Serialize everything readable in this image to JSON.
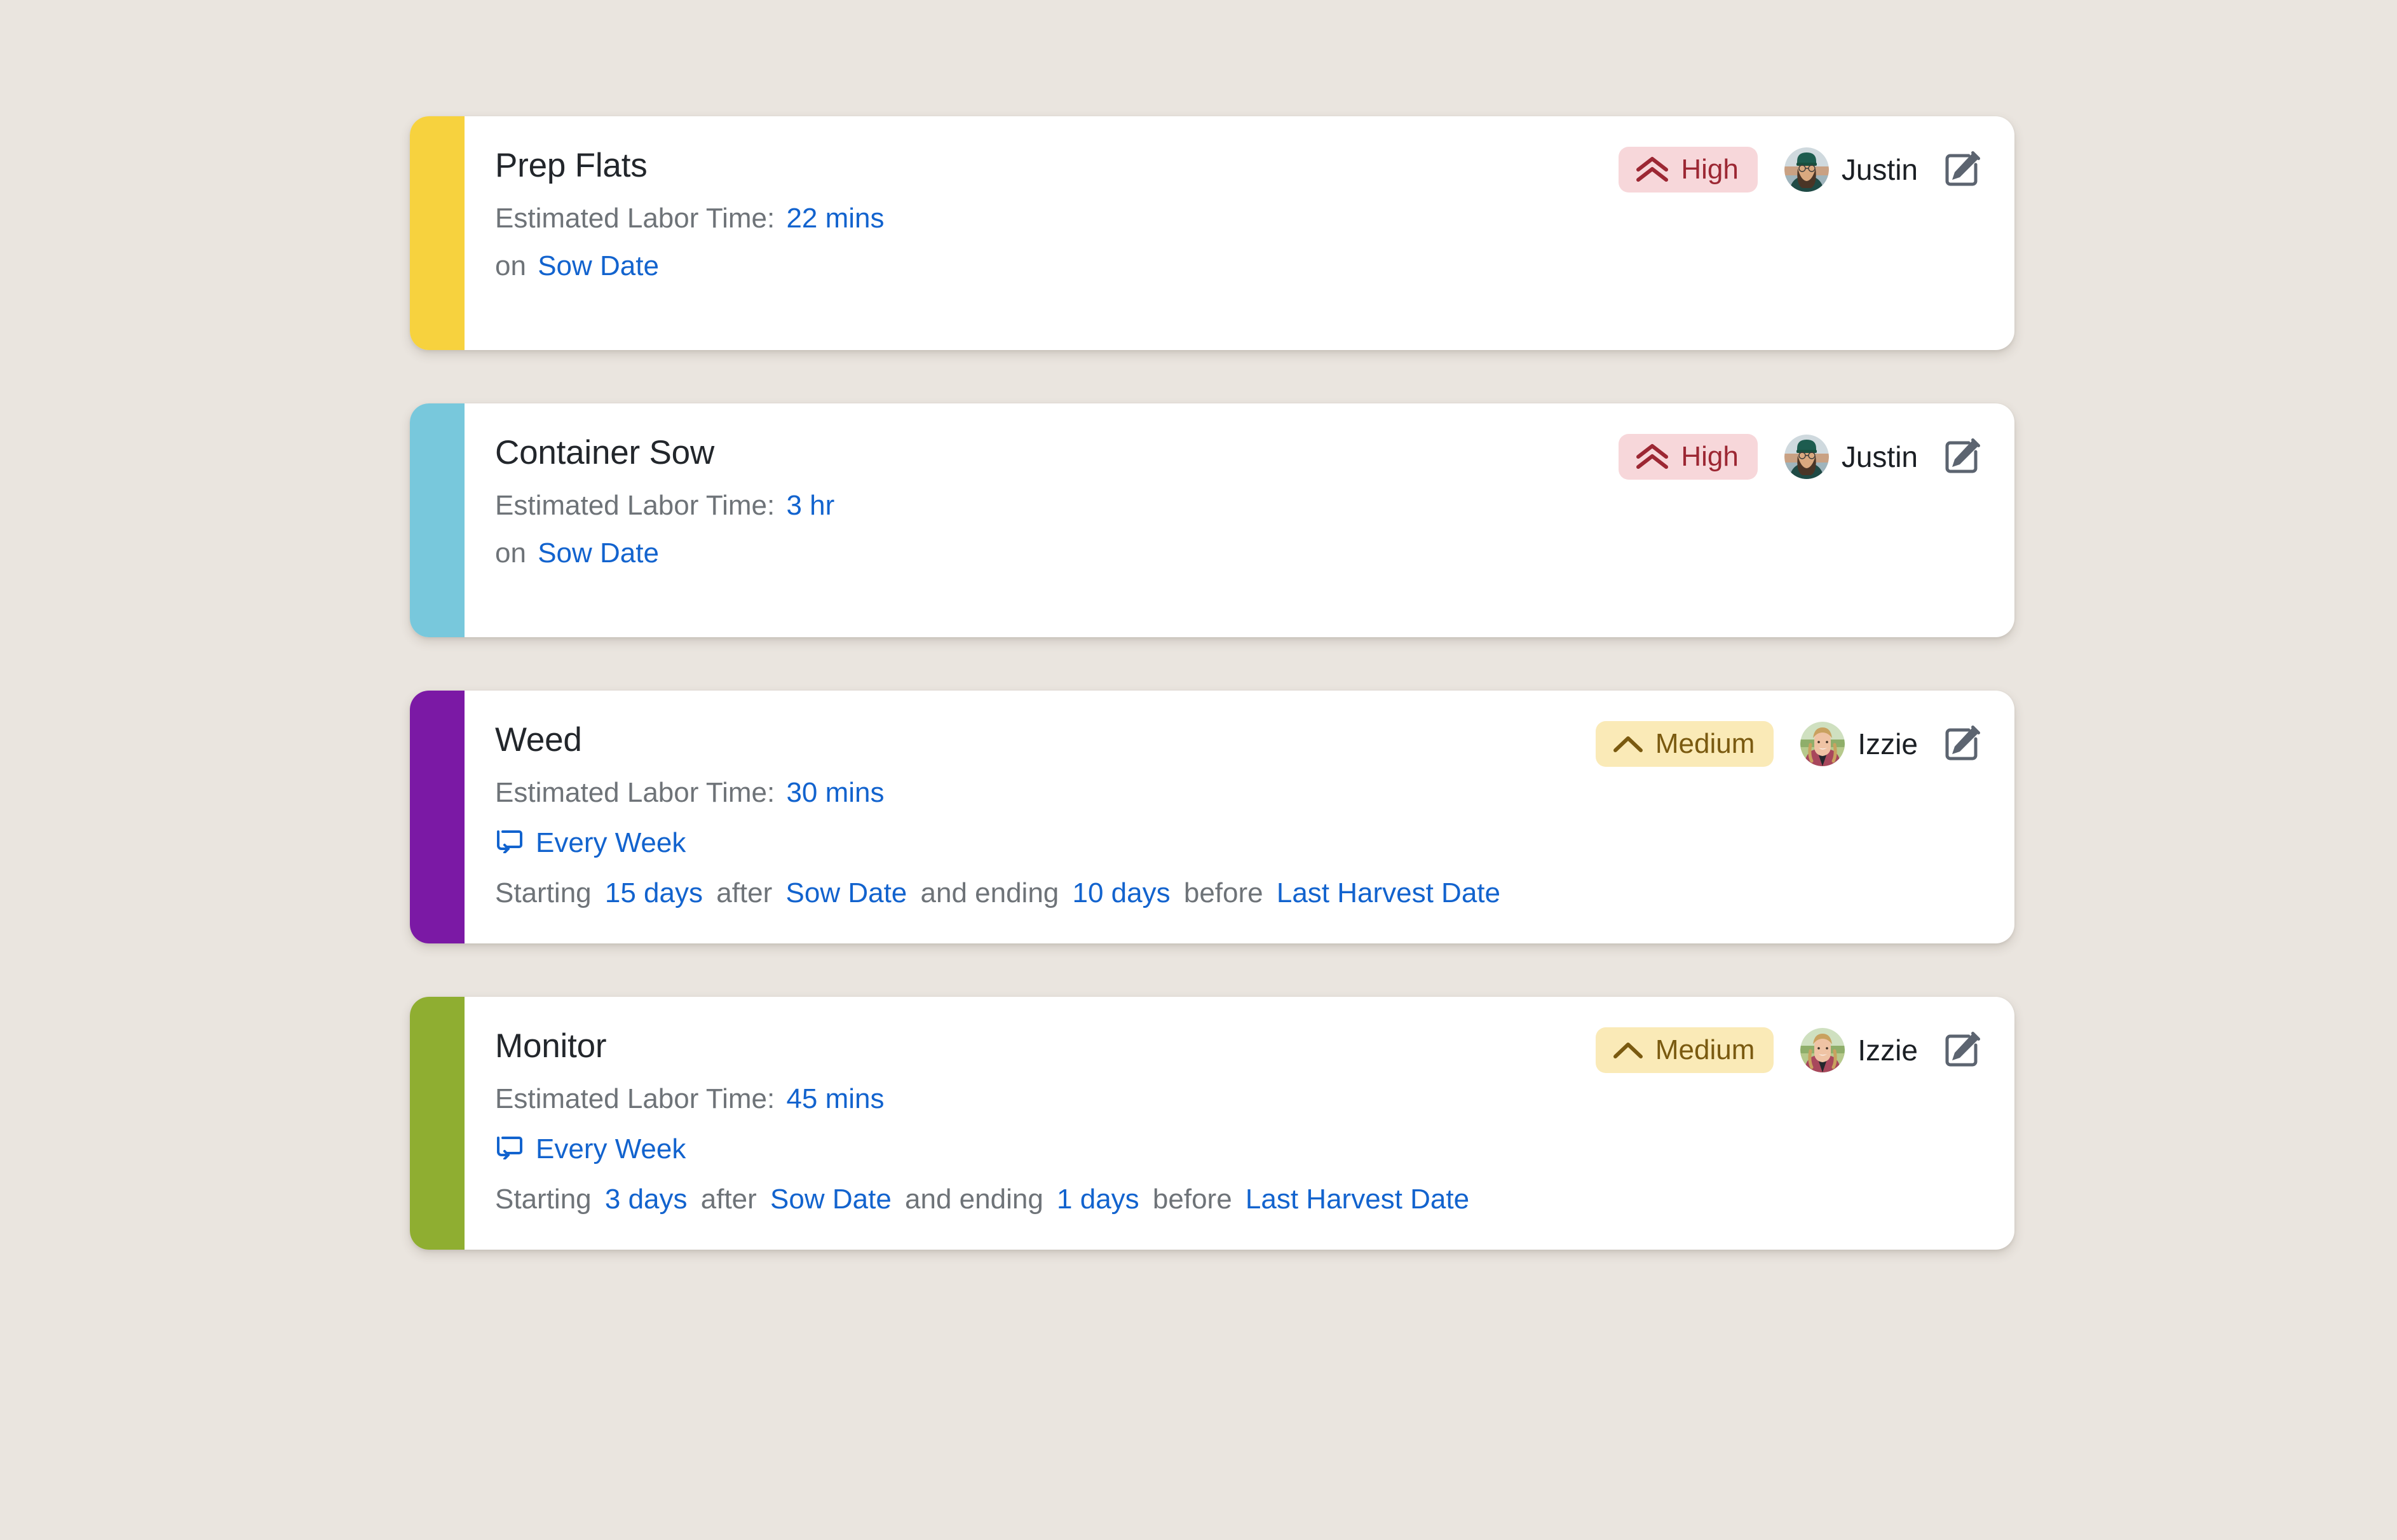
{
  "page": {
    "background_color": "#eae5df"
  },
  "colors": {
    "link": "#1263ce",
    "muted_text": "#6e7378",
    "title_text": "#22262b",
    "high_badge_bg": "#f7d7da",
    "high_badge_text": "#9c2733",
    "medium_badge_bg": "#faeab7",
    "medium_badge_text": "#7a5a10",
    "edit_icon": "#5c6470"
  },
  "labels": {
    "estimated_labor_time": "Estimated Labor Time:",
    "on": "on",
    "starting": "Starting",
    "after": "after",
    "and_ending": "and ending",
    "before": "before"
  },
  "cards": [
    {
      "title": "Prep Flats",
      "stripe_color": "#f7d23e",
      "labor_time": "22 mins",
      "schedule_type": "on",
      "anchor_date": "Sow Date",
      "priority": {
        "label": "High",
        "level": "high",
        "icon": "double-chevron-up-icon"
      },
      "assignee": {
        "name": "Justin",
        "avatar": "justin-avatar"
      },
      "edit_icon": "edit-pencil-icon"
    },
    {
      "title": "Container Sow",
      "stripe_color": "#78c8dc",
      "labor_time": "3 hr",
      "schedule_type": "on",
      "anchor_date": "Sow Date",
      "priority": {
        "label": "High",
        "level": "high",
        "icon": "double-chevron-up-icon"
      },
      "assignee": {
        "name": "Justin",
        "avatar": "justin-avatar"
      },
      "edit_icon": "edit-pencil-icon"
    },
    {
      "title": "Weed",
      "stripe_color": "#7b19a5",
      "labor_time": "30 mins",
      "schedule_type": "recurring",
      "recurrence": "Every Week",
      "recurrence_icon": "repeat-icon",
      "start_offset": "15 days",
      "start_anchor": "Sow Date",
      "end_offset": "10 days",
      "end_anchor": "Last Harvest Date",
      "priority": {
        "label": "Medium",
        "level": "medium",
        "icon": "chevron-up-icon"
      },
      "assignee": {
        "name": "Izzie",
        "avatar": "izzie-avatar"
      },
      "edit_icon": "edit-pencil-icon"
    },
    {
      "title": "Monitor",
      "stripe_color": "#8fae31",
      "labor_time": "45 mins",
      "schedule_type": "recurring",
      "recurrence": "Every Week",
      "recurrence_icon": "repeat-icon",
      "start_offset": "3 days",
      "start_anchor": "Sow Date",
      "end_offset": "1 days",
      "end_anchor": "Last Harvest Date",
      "priority": {
        "label": "Medium",
        "level": "medium",
        "icon": "chevron-up-icon"
      },
      "assignee": {
        "name": "Izzie",
        "avatar": "izzie-avatar"
      },
      "edit_icon": "edit-pencil-icon"
    }
  ]
}
